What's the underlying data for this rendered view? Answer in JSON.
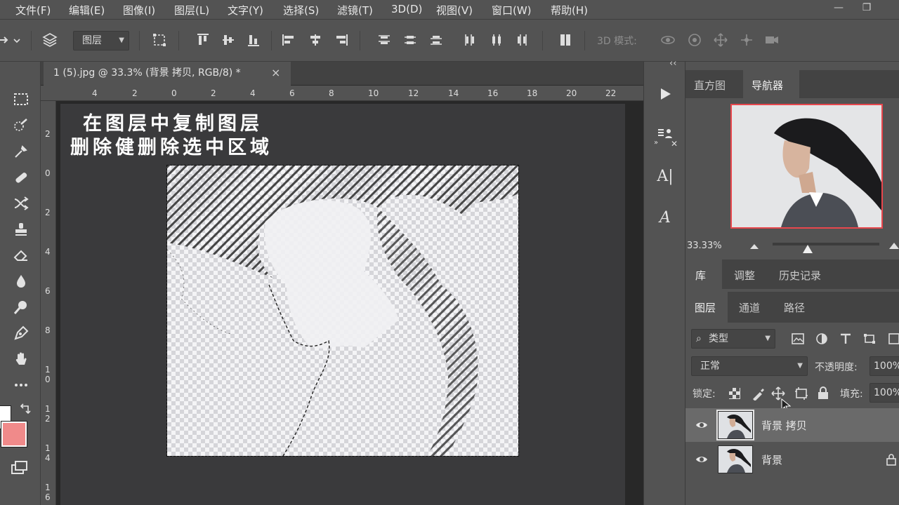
{
  "menu": [
    "文件(F)",
    "编辑(E)",
    "图像(I)",
    "图层(L)",
    "文字(Y)",
    "选择(S)",
    "滤镜(T)",
    "3D(D)",
    "视图(V)",
    "窗口(W)",
    "帮助(H)"
  ],
  "window_controls": {
    "minimize": "—",
    "restore": "❐"
  },
  "options_bar": {
    "auto_select_value": "图层",
    "mode_3d_label": "3D 模式:"
  },
  "document": {
    "tab_title": "1 (5).jpg @ 33.3% (背景 拷贝, RGB/8) *",
    "tab_close": "×",
    "overlay_line1": "在图层中复制图层",
    "overlay_line2": "删除健删除选中区域",
    "ruler_h": [
      "4",
      "2",
      "0",
      "2",
      "4",
      "6",
      "8",
      "10",
      "12",
      "14",
      "16",
      "18",
      "20",
      "22"
    ],
    "ruler_v": [
      "2",
      "0",
      "2",
      "4",
      "6",
      "8",
      "10",
      "12",
      "14",
      "16"
    ]
  },
  "mid_collapse": "‹‹",
  "navigator": {
    "tabs": [
      "直方图",
      "导航器"
    ],
    "active_tab": "导航器",
    "zoom": "33.33%",
    "zoom_level": 0.33
  },
  "library_panel": {
    "tabs": [
      "库",
      "调整",
      "历史记录"
    ]
  },
  "layers_panel": {
    "tabs": [
      "图层",
      "通道",
      "路径"
    ],
    "filter_kind": "类型",
    "blend_mode": "正常",
    "opacity_label": "不透明度:",
    "opacity_value": "100%",
    "lock_label": "锁定:",
    "fill_label": "填充:",
    "fill_value": "100%",
    "layers": [
      {
        "name": "背景 拷贝",
        "visible": true,
        "selected": true,
        "locked": false
      },
      {
        "name": "背景",
        "visible": true,
        "selected": false,
        "locked": true
      }
    ]
  },
  "colors": {
    "ui_bg": "#535353",
    "canvas_bg": "#282828",
    "foreground_swatch": "#ffffff",
    "background_swatch": "#f08a8a",
    "navigator_frame": "#e8474d"
  }
}
